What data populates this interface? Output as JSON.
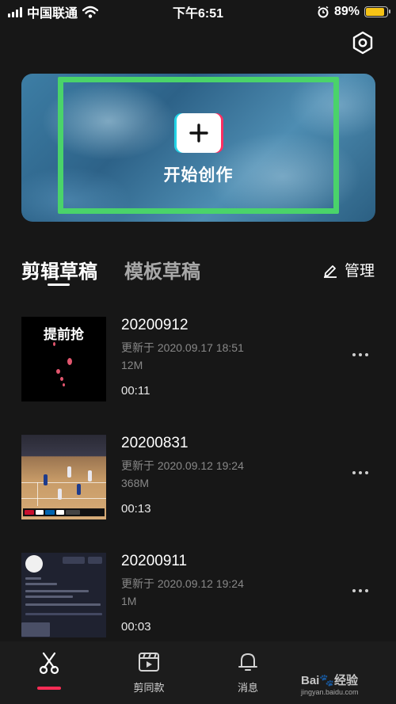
{
  "status_bar": {
    "carrier": "中国联通",
    "time": "下午6:51",
    "battery": "89%",
    "battery_level": 0.89,
    "battery_color": "#f6c316"
  },
  "header": {
    "settings_icon": "gear-hexagon-icon"
  },
  "banner": {
    "create_label": "开始创作",
    "highlight_color": "#4ad36a"
  },
  "tabs": [
    {
      "label": "剪辑草稿",
      "active": true
    },
    {
      "label": "模板草稿",
      "active": false
    }
  ],
  "manage": {
    "label": "管理",
    "icon": "pencil-icon"
  },
  "drafts": [
    {
      "title": "20200912",
      "updated": "更新于 2020.09.17 18:51",
      "size": "12M",
      "duration": "00:11",
      "thumb_text": "提前抢"
    },
    {
      "title": "20200831",
      "updated": "更新于 2020.09.12 19:24",
      "size": "368M",
      "duration": "00:13"
    },
    {
      "title": "20200911",
      "updated": "更新于 2020.09.12 19:24",
      "size": "1M",
      "duration": "00:03"
    }
  ],
  "bottom_nav": [
    {
      "label": "",
      "icon": "scissors-icon",
      "active": true
    },
    {
      "label": "剪同款",
      "icon": "template-clapper-icon"
    },
    {
      "label": "消息",
      "icon": "bell-icon"
    }
  ],
  "watermark": {
    "text": "Bai🐾经验",
    "sub": "jingyan.baidu.com"
  },
  "accent_color": "#fe2c55"
}
